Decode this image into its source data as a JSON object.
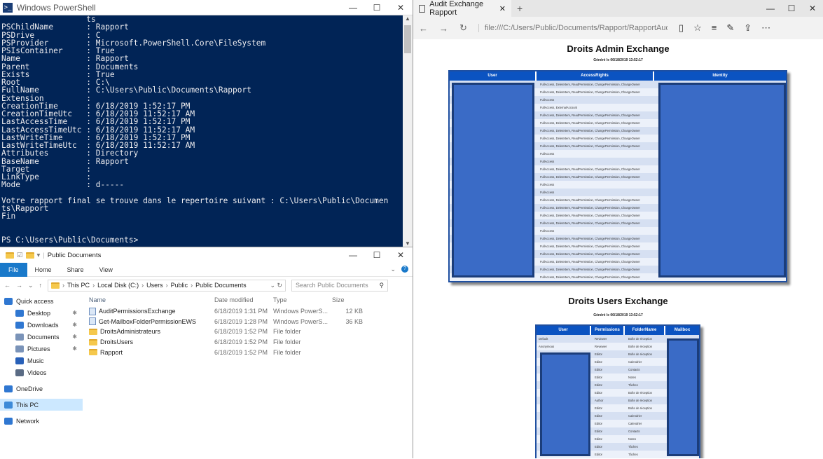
{
  "powershell": {
    "title": "Windows PowerShell",
    "lines": [
      "                  ts",
      "PSChildName       : Rapport",
      "PSDrive           : C",
      "PSProvider        : Microsoft.PowerShell.Core\\FileSystem",
      "PSIsContainer     : True",
      "Name              : Rapport",
      "Parent            : Documents",
      "Exists            : True",
      "Root              : C:\\",
      "FullName          : C:\\Users\\Public\\Documents\\Rapport",
      "Extension         :",
      "CreationTime      : 6/18/2019 1:52:17 PM",
      "CreationTimeUtc   : 6/18/2019 11:52:17 AM",
      "LastAccessTime    : 6/18/2019 1:52:17 PM",
      "LastAccessTimeUtc : 6/18/2019 11:52:17 AM",
      "LastWriteTime     : 6/18/2019 1:52:17 PM",
      "LastWriteTimeUtc  : 6/18/2019 11:52:17 AM",
      "Attributes        : Directory",
      "BaseName          : Rapport",
      "Target            :",
      "LinkType          :",
      "Mode              : d-----",
      "",
      "Votre rapport final se trouve dans le repertoire suivant : C:\\Users\\Public\\Documen",
      "ts\\Rapport",
      "Fin",
      "",
      "",
      "PS C:\\Users\\Public\\Documents>"
    ]
  },
  "explorer": {
    "title": "Public Documents",
    "ribbon_tabs": [
      "File",
      "Home",
      "Share",
      "View"
    ],
    "breadcrumb": [
      "This PC",
      "Local Disk (C:)",
      "Users",
      "Public",
      "Public Documents"
    ],
    "search_placeholder": "Search Public Documents",
    "nav": [
      {
        "label": "Quick access",
        "icon": "star-icon",
        "top": true
      },
      {
        "label": "Desktop",
        "icon": "desktop-icon",
        "pin": true
      },
      {
        "label": "Downloads",
        "icon": "download-icon",
        "pin": true
      },
      {
        "label": "Documents",
        "icon": "documents-icon",
        "pin": true
      },
      {
        "label": "Pictures",
        "icon": "pictures-icon",
        "pin": true
      },
      {
        "label": "Music",
        "icon": "music-icon"
      },
      {
        "label": "Videos",
        "icon": "videos-icon"
      },
      {
        "label": "OneDrive",
        "icon": "cloud-icon",
        "top": true
      },
      {
        "label": "This PC",
        "icon": "computer-icon",
        "top": true,
        "selected": true
      },
      {
        "label": "Network",
        "icon": "network-icon",
        "top": true
      }
    ],
    "columns": {
      "name": "Name",
      "date": "Date modified",
      "type": "Type",
      "size": "Size"
    },
    "files": [
      {
        "name": "AuditPermissionsExchange",
        "date": "6/18/2019 1:31 PM",
        "type": "Windows PowerS...",
        "size": "12 KB",
        "kind": "script"
      },
      {
        "name": "Get-MailboxFolderPermissionEWS",
        "date": "6/18/2019 1:28 PM",
        "type": "Windows PowerS...",
        "size": "36 KB",
        "kind": "script"
      },
      {
        "name": "DroitsAdministrateurs",
        "date": "6/18/2019 1:52 PM",
        "type": "File folder",
        "size": "",
        "kind": "folder"
      },
      {
        "name": "DroitsUsers",
        "date": "6/18/2019 1:52 PM",
        "type": "File folder",
        "size": "",
        "kind": "folder"
      },
      {
        "name": "Rapport",
        "date": "6/18/2019 1:52 PM",
        "type": "File folder",
        "size": "",
        "kind": "folder"
      }
    ]
  },
  "edge": {
    "tab_title": "Audit Exchange Rapport",
    "url": "file:///C:/Users/Public/Documents/Rapport/RapportAudit.h",
    "admin": {
      "title": "Droits Admin Exchange",
      "generated": "Généré le 06/18/2019 13:52:17",
      "headers": [
        "User",
        "AccessRights",
        "Identity"
      ],
      "rows": [
        "FullAccess, DeleteItem, ReadPermission, ChangePermission, ChangeOwner",
        "FullAccess, DeleteItem, ReadPermission, ChangePermission, ChangeOwner",
        "FullAccess",
        "FullAccess, ExternalAccount",
        "FullAccess, DeleteItem, ReadPermission, ChangePermission, ChangeOwner",
        "FullAccess, DeleteItem, ReadPermission, ChangePermission, ChangeOwner",
        "FullAccess, DeleteItem, ReadPermission, ChangePermission, ChangeOwner",
        "FullAccess, DeleteItem, ReadPermission, ChangePermission, ChangeOwner",
        "FullAccess, DeleteItem, ReadPermission, ChangePermission, ChangeOwner",
        "FullAccess",
        "FullAccess",
        "FullAccess, DeleteItem, ReadPermission, ChangePermission, ChangeOwner",
        "FullAccess, DeleteItem, ReadPermission, ChangePermission, ChangeOwner",
        "FullAccess",
        "FullAccess",
        "FullAccess, DeleteItem, ReadPermission, ChangePermission, ChangeOwner",
        "FullAccess, DeleteItem, ReadPermission, ChangePermission, ChangeOwner",
        "FullAccess, DeleteItem, ReadPermission, ChangePermission, ChangeOwner",
        "FullAccess, DeleteItem, ReadPermission, ChangePermission, ChangeOwner",
        "FullAccess",
        "FullAccess, DeleteItem, ReadPermission, ChangePermission, ChangeOwner",
        "FullAccess, DeleteItem, ReadPermission, ChangePermission, ChangeOwner",
        "FullAccess, DeleteItem, ReadPermission, ChangePermission, ChangeOwner",
        "FullAccess, DeleteItem, ReadPermission, ChangePermission, ChangeOwner",
        "FullAccess, DeleteItem, ReadPermission, ChangePermission, ChangeOwner",
        "FullAccess, DeleteItem, ReadPermission, ChangePermission, ChangeOwner"
      ]
    },
    "users": {
      "title": "Droits Users Exchange",
      "generated": "Généré le 06/18/2019 13:52:17",
      "headers": [
        "User",
        "Permissions",
        "FolderName",
        "Mailbox"
      ],
      "rows": [
        {
          "user": "Default",
          "perm": "Reviewer",
          "folder": "Boîte de réception"
        },
        {
          "user": "Anonymous",
          "perm": "Reviewer",
          "folder": "Boîte de réception"
        },
        {
          "user": "",
          "perm": "Editor",
          "folder": "Boîte de réception"
        },
        {
          "user": "",
          "perm": "Editor",
          "folder": "Calendrier"
        },
        {
          "user": "",
          "perm": "Editor",
          "folder": "Contacts"
        },
        {
          "user": "",
          "perm": "Editor",
          "folder": "Notes"
        },
        {
          "user": "",
          "perm": "Editor",
          "folder": "Tâches"
        },
        {
          "user": "",
          "perm": "Editor",
          "folder": "Boîte de réception"
        },
        {
          "user": "",
          "perm": "Author",
          "folder": "Boîte de réception"
        },
        {
          "user": "",
          "perm": "Editor",
          "folder": "Boîte de réception"
        },
        {
          "user": "",
          "perm": "Editor",
          "folder": "Calendrier"
        },
        {
          "user": "",
          "perm": "Editor",
          "folder": "Calendrier"
        },
        {
          "user": "",
          "perm": "Editor",
          "folder": "Contacts"
        },
        {
          "user": "",
          "perm": "Editor",
          "folder": "Notes"
        },
        {
          "user": "",
          "perm": "Editor",
          "folder": "Tâches"
        },
        {
          "user": "",
          "perm": "Editor",
          "folder": "Tâches"
        }
      ]
    }
  }
}
